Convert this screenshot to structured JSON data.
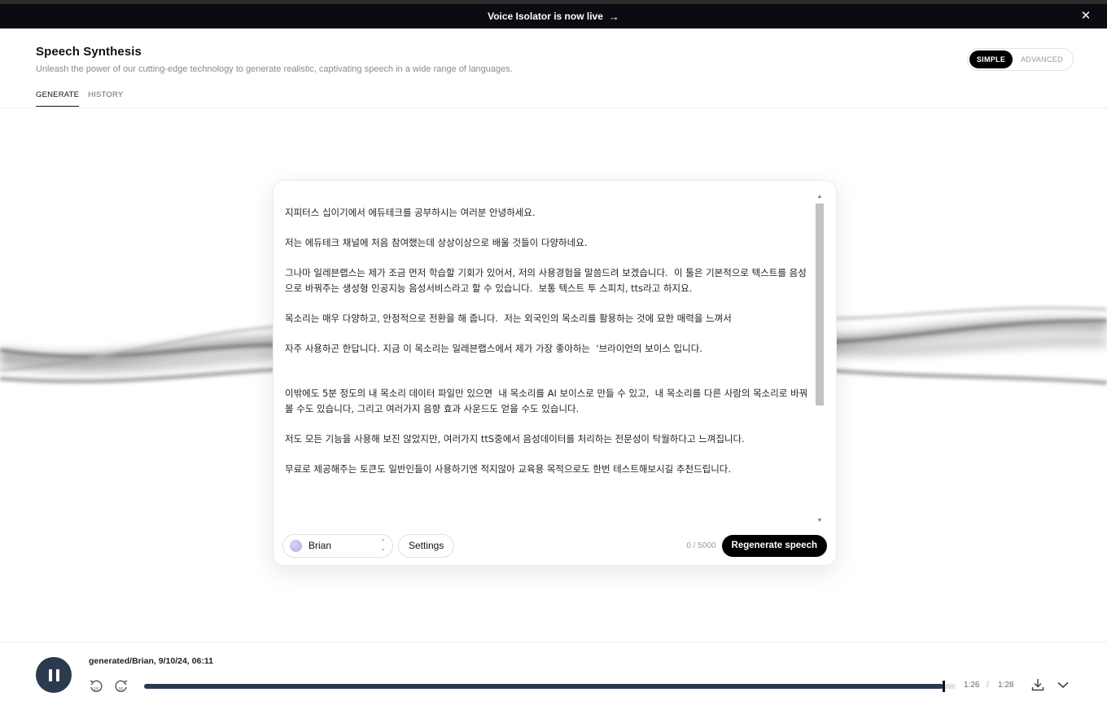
{
  "banner": {
    "text": "Voice Isolator is now live",
    "arrow": "→",
    "close": "✕"
  },
  "header": {
    "title": "Speech Synthesis",
    "subtitle": "Unleash the power of our cutting-edge technology to generate realistic, captivating speech in a wide range of languages."
  },
  "mode": {
    "simple": "SIMPLE",
    "advanced": "ADVANCED",
    "selected": "SIMPLE"
  },
  "tabs": [
    {
      "label": "GENERATE",
      "active": true
    },
    {
      "label": "HISTORY",
      "active": false
    }
  ],
  "editor": {
    "paragraphs": [
      "지피터스 십이기에서 에듀테크를 공부하시는 여러분 안녕하세요.",
      "저는 에듀테크 채널에 처음 참여했는데 상상이상으로 배울 것들이 다양하네요.",
      "그나마 일레븐랩스는 제가 조금 먼저 학습할 기회가 있어서, 저의 사용경험을 말씀드려 보겠습니다.  이 툴은 기본적으로 텍스트를 음성으로 바꿔주는 생성형 인공지능 음성서비스라고 할 수 있습니다.  보통 텍스트 투 스피치, tts라고 하지요.",
      "목소리는 매우 다양하고, 안정적으로 전환을 해 줍니다.  저는 외국인의 목소리를 활용하는 것에 묘한 매력을 느껴서",
      "자주 사용하곤 한답니다. 지금 이 목소리는 일레븐랩스에서 제가 가장 좋아하는  '브라이언의 보이스 입니다.",
      "",
      "이밖에도 5분 정도의 내 목소리 데이터 파일만 있으면  내 목소리를 AI 보이스로 만들 수 있고,  내 목소리를 다른 사람의 목소리로 바꿔 볼 수도 있습니다, 그리고 여러가지 음향 효과 사운드도 얻을 수도 있습니다.",
      "저도 모든 기능을 사용해 보진 않았지만, 여러가지 ttS중에서 음성데이터를 처리하는 전문성이 탁월하다고 느껴집니다.",
      "무료로 제공해주는 토큰도 일반인들이 사용하기엔 적지않아 교육용 목적으로도 한번 테스트해보시길 추천드립니다."
    ],
    "voice": "Brian",
    "settings_label": "Settings",
    "char_count": "0 / 5000",
    "regenerate_label": "Regenerate speech"
  },
  "player": {
    "track": "generated/Brian, 9/10/24, 06:11",
    "current_time": "1:26",
    "separator": "/",
    "total_time": "1:28",
    "progress": 0.985
  },
  "icons": {
    "banner_close": "close-icon",
    "play_state": "pause-icon",
    "skip_back": "rewind-10-icon",
    "skip_forward": "forward-10-icon",
    "download": "download-icon",
    "collapse": "chevron-down-icon"
  },
  "colors": {
    "banner": "#0b0b14",
    "accent": "#2b3a4e",
    "button": "#000000"
  }
}
